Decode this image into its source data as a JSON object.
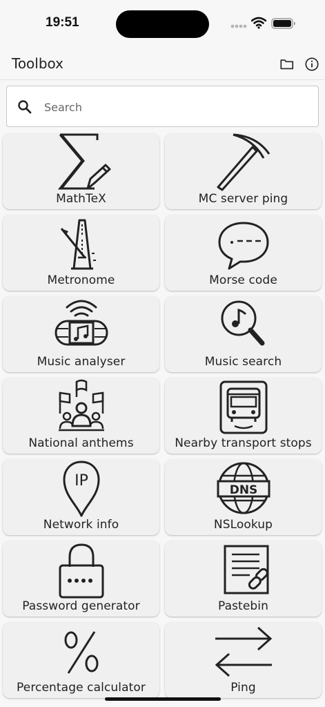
{
  "status_bar": {
    "time": "19:51"
  },
  "app_bar": {
    "title": "Toolbox",
    "actions": [
      "folder-icon",
      "info-icon"
    ]
  },
  "search": {
    "placeholder": "Search",
    "value": ""
  },
  "tools": [
    {
      "label": "MathTeX",
      "icon": "sigma-pencil-icon"
    },
    {
      "label": "MC server ping",
      "icon": "pickaxe-icon"
    },
    {
      "label": "Metronome",
      "icon": "metronome-icon"
    },
    {
      "label": "Morse code",
      "icon": "speech-bubble-morse-icon"
    },
    {
      "label": "Music analyser",
      "icon": "radio-music-icon"
    },
    {
      "label": "Music search",
      "icon": "music-magnifier-icon"
    },
    {
      "label": "National anthems",
      "icon": "people-flags-icon"
    },
    {
      "label": "Nearby transport stops",
      "icon": "bus-stop-icon"
    },
    {
      "label": "Network info",
      "icon": "ip-pin-icon"
    },
    {
      "label": "NSLookup",
      "icon": "dns-globe-icon"
    },
    {
      "label": "Password generator",
      "icon": "padlock-icon"
    },
    {
      "label": "Pastebin",
      "icon": "document-link-icon"
    },
    {
      "label": "Percentage calculator",
      "icon": "percent-icon"
    },
    {
      "label": "Ping",
      "icon": "arrows-exchange-icon"
    }
  ]
}
